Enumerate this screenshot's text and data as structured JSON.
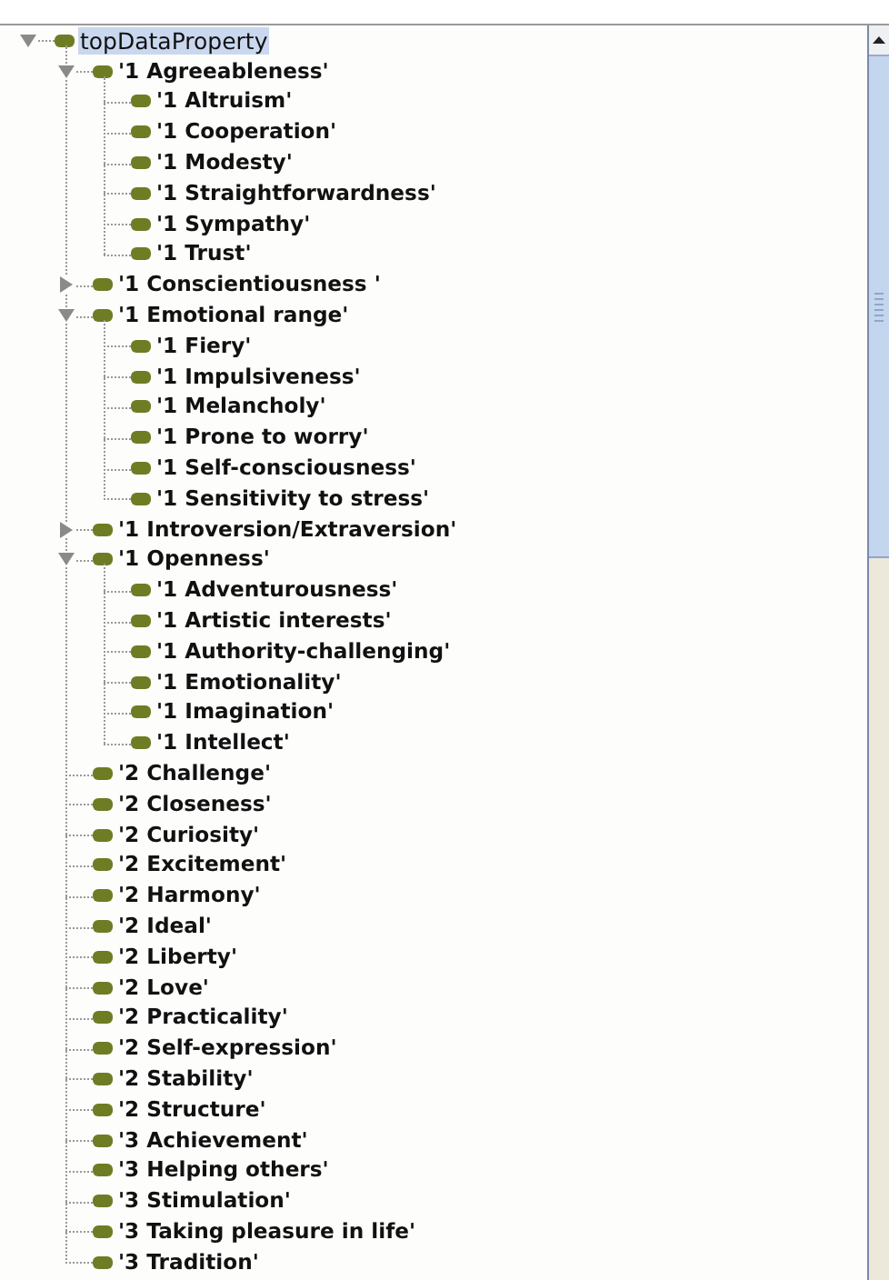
{
  "tree": [
    {
      "label": "topDataProperty",
      "selected": true,
      "expanded": true,
      "children": [
        {
          "label": "'1 Agreeableness'",
          "selected": false,
          "expanded": true,
          "children": [
            {
              "label": "'1 Altruism'",
              "selected": false
            },
            {
              "label": "'1 Cooperation'",
              "selected": false
            },
            {
              "label": "'1 Modesty'",
              "selected": false
            },
            {
              "label": "'1 Straightforwardness'",
              "selected": false
            },
            {
              "label": "'1 Sympathy'",
              "selected": false
            },
            {
              "label": "'1 Trust'",
              "selected": false
            }
          ]
        },
        {
          "label": "'1 Conscientiousness '",
          "selected": false,
          "expanded": false
        },
        {
          "label": "'1 Emotional range'",
          "selected": false,
          "expanded": true,
          "children": [
            {
              "label": "'1 Fiery'",
              "selected": false
            },
            {
              "label": "'1 Impulsiveness'",
              "selected": false
            },
            {
              "label": "'1 Melancholy'",
              "selected": false
            },
            {
              "label": "'1 Prone to worry'",
              "selected": false
            },
            {
              "label": "'1 Self-consciousness'",
              "selected": false
            },
            {
              "label": "'1 Sensitivity to stress'",
              "selected": false
            }
          ]
        },
        {
          "label": "'1 Introversion/Extraversion'",
          "selected": false,
          "expanded": false
        },
        {
          "label": "'1 Openness'",
          "selected": false,
          "expanded": true,
          "children": [
            {
              "label": "'1 Adventurousness'",
              "selected": false
            },
            {
              "label": "'1 Artistic interests'",
              "selected": false
            },
            {
              "label": "'1 Authority-challenging'",
              "selected": false
            },
            {
              "label": "'1 Emotionality'",
              "selected": false
            },
            {
              "label": "'1 Imagination'",
              "selected": false
            },
            {
              "label": "'1 Intellect'",
              "selected": false
            }
          ]
        },
        {
          "label": "'2 Challenge'",
          "selected": false
        },
        {
          "label": "'2 Closeness'",
          "selected": false
        },
        {
          "label": "'2 Curiosity'",
          "selected": false
        },
        {
          "label": "'2 Excitement'",
          "selected": false
        },
        {
          "label": "'2 Harmony'",
          "selected": false
        },
        {
          "label": "'2 Ideal'",
          "selected": false
        },
        {
          "label": "'2 Liberty'",
          "selected": false
        },
        {
          "label": "'2 Love'",
          "selected": false
        },
        {
          "label": "'2 Practicality'",
          "selected": false
        },
        {
          "label": "'2 Self-expression'",
          "selected": false
        },
        {
          "label": "'2 Stability'",
          "selected": false
        },
        {
          "label": "'2 Structure'",
          "selected": false
        },
        {
          "label": "'3 Achievement'",
          "selected": false
        },
        {
          "label": "'3 Helping others'",
          "selected": false
        },
        {
          "label": "'3 Stimulation'",
          "selected": false
        },
        {
          "label": "'3 Taking pleasure in life'",
          "selected": false
        },
        {
          "label": "'3 Tradition'",
          "selected": false
        }
      ]
    }
  ]
}
